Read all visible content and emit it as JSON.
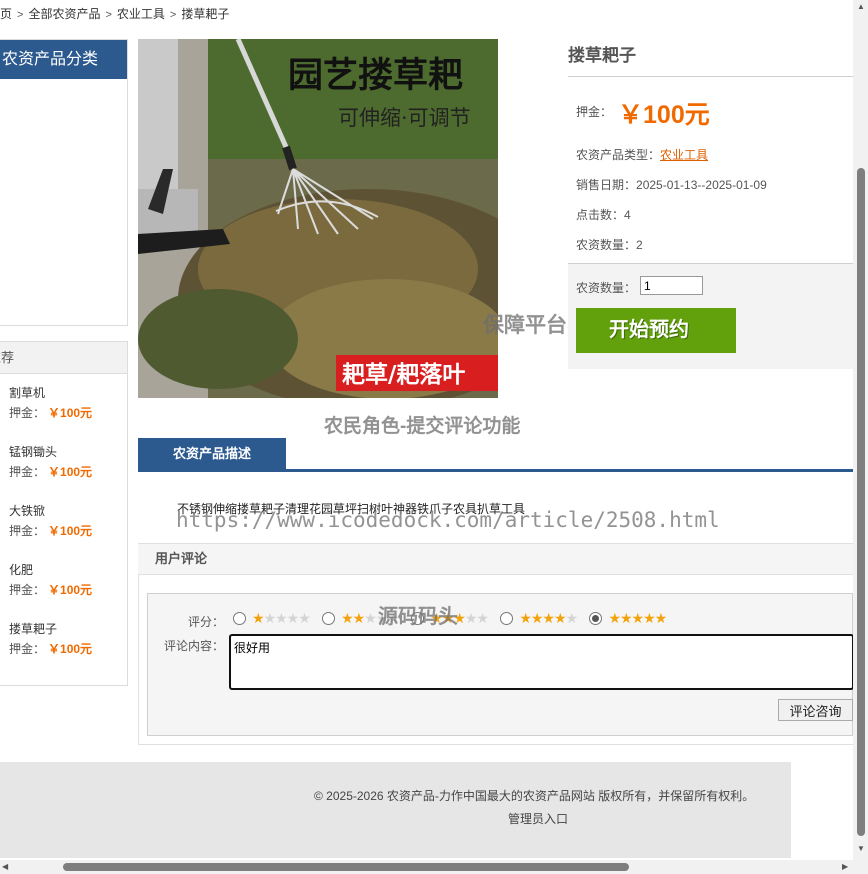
{
  "breadcrumb": {
    "items": [
      "首页",
      "全部农资产品",
      "农业工具",
      "搂草耙子"
    ],
    "separator": ">"
  },
  "sidebar": {
    "category_title": "农资产品分类",
    "recommend_title": "推荐",
    "items": [
      {
        "name": "割草机",
        "price_label": "押金：",
        "price": "￥100元"
      },
      {
        "name": "锰钢锄头",
        "price_label": "押金：",
        "price": "￥100元"
      },
      {
        "name": "大铁锨",
        "price_label": "押金：",
        "price": "￥100元"
      },
      {
        "name": "化肥",
        "price_label": "押金：",
        "price": "￥100元"
      },
      {
        "name": "搂草耙子",
        "price_label": "押金：",
        "price": "￥100元"
      }
    ]
  },
  "product": {
    "image": {
      "title": "园艺搂草耙",
      "subtitle": "可伸缩·可调节",
      "badge": "耙草/耙落叶"
    },
    "title": "搂草耙子",
    "deposit_label": "押金：",
    "deposit_value": "￥100元",
    "type_label": "农资产品类型：",
    "type_value": "农业工具",
    "date_label": "销售日期：",
    "date_value": "2025-01-13--2025-01-09",
    "clicks_label": "点击数：",
    "clicks_value": "4",
    "stock_label": "农资数量：",
    "stock_value": "2",
    "qty_label": "农资数量：",
    "qty_value": "1",
    "reserve_label": "开始预约"
  },
  "watermarks": {
    "platform": "保障平台",
    "role": "农民角色-提交评论功能",
    "url": "https://www.icodedock.com/article/2508.html",
    "brand": "源码码头"
  },
  "tabs": {
    "active": "农资产品描述"
  },
  "description": "不锈钢伸缩搂草耙子清理花园草坪扫树叶神器铁爪子农具扒草工具",
  "comments": {
    "title": "用户评论",
    "rating_label": "评分：",
    "rating_options": [
      1,
      2,
      3,
      4,
      5
    ],
    "selected_rating": 5,
    "content_label": "评论内容：",
    "content_value": "很好用",
    "submit_label": "评论咨询"
  },
  "footer": {
    "copyright": "© 2025-2026 农资产品-力作中国最大的农资产品网站 版权所有，并保留所有权利。",
    "admin_link": "管理员入口"
  }
}
